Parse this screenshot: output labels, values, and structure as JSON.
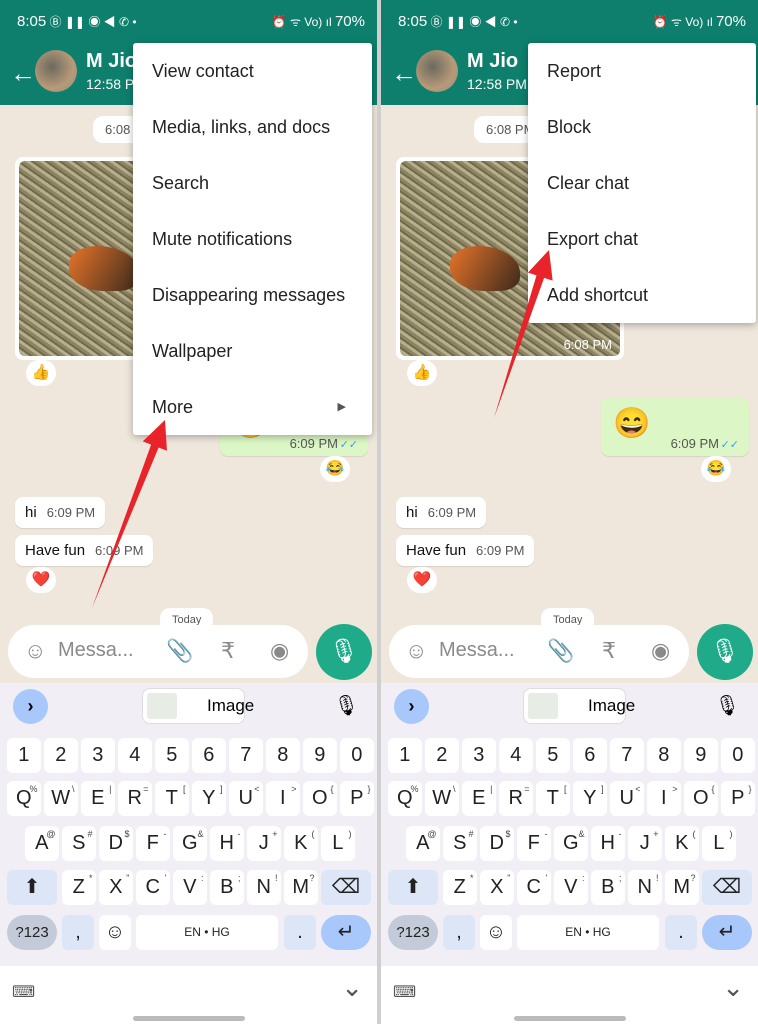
{
  "panels": [
    {
      "menu": {
        "items": [
          "View contact",
          "Media, links, and docs",
          "Search",
          "Mute notifications",
          "Disappearing messages",
          "Wallpaper",
          "More"
        ],
        "submenu_index": 6,
        "wide": true
      },
      "arrow": {
        "from": [
          92,
          608
        ],
        "to": [
          165,
          420
        ]
      }
    },
    {
      "menu": {
        "items": [
          "Report",
          "Block",
          "Clear chat",
          "Export chat",
          "Add shortcut"
        ],
        "submenu_index": -1,
        "wide": false
      },
      "arrow": {
        "from": [
          113,
          418
        ],
        "to": [
          168,
          250
        ]
      }
    }
  ],
  "status": {
    "time": "8:05",
    "battery": "70%",
    "icons": "Ⓑ ❚❚ ◉ ◀ ✆ •",
    "right_icons": "⏰ ᯤ Vo) ıl"
  },
  "header": {
    "contact_name": "M Jio",
    "last_seen": "12:58 PM"
  },
  "chat": {
    "date_pill": "6:08 PM",
    "image_time": "6:08 PM",
    "image_reaction": "👍",
    "emoji_message": "😄",
    "emoji_time": "6:09 PM",
    "emoji_reaction": "😂",
    "read_ticks": "✓✓",
    "messages": [
      {
        "text": "hi",
        "time": "6:09 PM"
      },
      {
        "text": "Have fun",
        "time": "6:09 PM"
      }
    ],
    "fun_reaction": "❤️",
    "today_pill": "Today"
  },
  "input": {
    "placeholder": "Messa..."
  },
  "keyboard": {
    "suggestion": "Image",
    "numbers": [
      "1",
      "2",
      "3",
      "4",
      "5",
      "6",
      "7",
      "8",
      "9",
      "0"
    ],
    "row1": [
      "Q",
      "W",
      "E",
      "R",
      "T",
      "Y",
      "U",
      "I",
      "O",
      "P"
    ],
    "row1_alt": [
      "%",
      "\\",
      "|",
      "=",
      "[",
      "]",
      "<",
      ">",
      "{",
      "}"
    ],
    "row2": [
      "A",
      "S",
      "D",
      "F",
      "G",
      "H",
      "J",
      "K",
      "L"
    ],
    "row2_alt": [
      "@",
      "#",
      "$",
      "-",
      "&",
      "-",
      "+",
      "(",
      ")"
    ],
    "row3": [
      "Z",
      "X",
      "C",
      "V",
      "B",
      "N",
      "M"
    ],
    "row3_alt": [
      "*",
      "\"",
      "'",
      ":",
      ";",
      "!",
      "?"
    ],
    "symbols_key": "?123",
    "comma": ",",
    "period": ".",
    "space_label": "EN • HG"
  },
  "colors": {
    "header": "#0d7f6c",
    "accent": "#1faa8a",
    "arrow": "#e8232a"
  }
}
